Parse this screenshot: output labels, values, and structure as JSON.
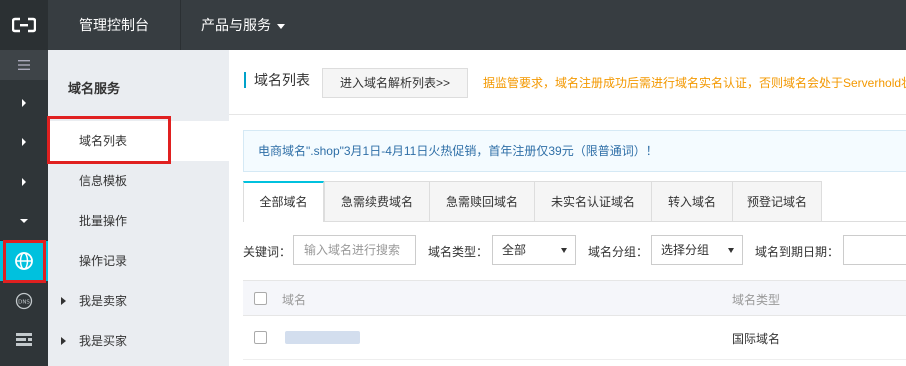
{
  "topbar": {
    "logo_icon": "aliyun-logo-icon",
    "title": "管理控制台",
    "menu_label": "产品与服务"
  },
  "iconbar": {
    "items": [
      "menu-icon",
      "chevron-right-icon",
      "chevron-right-icon",
      "chevron-right-icon",
      "chevron-down-icon",
      "globe-icon",
      "dns-icon",
      "server-icon"
    ],
    "active_color": "#00c1de"
  },
  "sidebar": {
    "title": "域名服务",
    "items": [
      {
        "label": "域名列表"
      },
      {
        "label": "信息模板"
      },
      {
        "label": "批量操作"
      },
      {
        "label": "操作记录"
      },
      {
        "label": "我是卖家"
      },
      {
        "label": "我是买家"
      }
    ]
  },
  "main": {
    "breadcrumb": "域名列表",
    "dns_button": "进入域名解析列表>>",
    "notice": "据监管要求，域名注册成功后需进行域名实名认证，否则域名会处于Serverhold状态",
    "promo": "电商域名\".shop\"3月1日-4月11日火热促销，首年注册仅39元（限普通词）！",
    "tabs": [
      "全部域名",
      "急需续费域名",
      "急需赎回域名",
      "未实名认证域名",
      "转入域名",
      "预登记域名"
    ],
    "filters": {
      "keyword_label": "关键词：",
      "keyword_placeholder": "输入域名进行搜索",
      "type_label": "域名类型：",
      "type_value": "全部",
      "group_label": "域名分组：",
      "group_value": "选择分组",
      "expiry_label": "域名到期日期："
    },
    "table": {
      "columns": [
        "域名",
        "域名类型"
      ],
      "rows": [
        {
          "domain": "",
          "type": "国际域名"
        }
      ]
    }
  },
  "colors": {
    "topbar": "#373d41",
    "accent": "#00c1de",
    "notice": "#f39800",
    "highlight_box": "#e02020"
  }
}
